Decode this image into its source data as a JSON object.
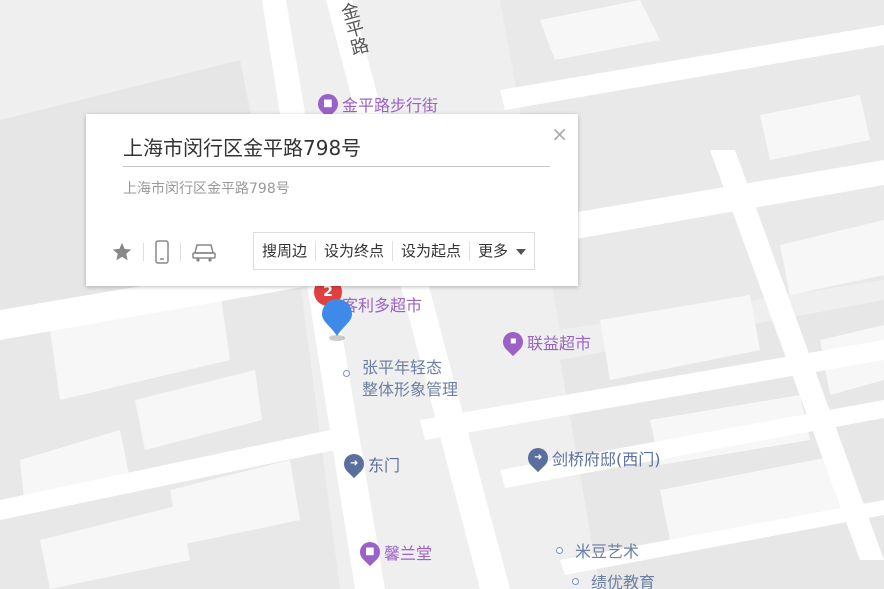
{
  "map": {
    "road_label": "金平路",
    "pois": [
      {
        "name": "金平路步行街",
        "kind": "shop",
        "color": "#9a62c6"
      },
      {
        "name": "客利多超市",
        "kind": "shop",
        "color": "#9a62c6"
      },
      {
        "name": "联益超市",
        "kind": "cart",
        "color": "#9a62c6"
      },
      {
        "name": "张平年轻态\n整体形象管理",
        "kind": "dot",
        "color": "#6b7fa3"
      },
      {
        "name": "东门",
        "kind": "gate",
        "color": "#5b6f9e"
      },
      {
        "name": "剑桥府邸(西门)",
        "kind": "gate",
        "color": "#5b6f9e"
      },
      {
        "name": "馨兰堂",
        "kind": "shop",
        "color": "#9a62c6"
      },
      {
        "name": "米豆艺术",
        "kind": "dot",
        "color": "#6b7fa3"
      },
      {
        "name": "绩优教育",
        "kind": "dot",
        "color": "#6b7fa3"
      }
    ],
    "cluster_count": "2",
    "marker_color": "#3f8ae8"
  },
  "popup": {
    "title": "上海市闵行区金平路798号",
    "address": "上海市闵行区金平路798号",
    "close": "×",
    "actions": [
      "搜周边",
      "设为终点",
      "设为起点",
      "更多"
    ]
  }
}
